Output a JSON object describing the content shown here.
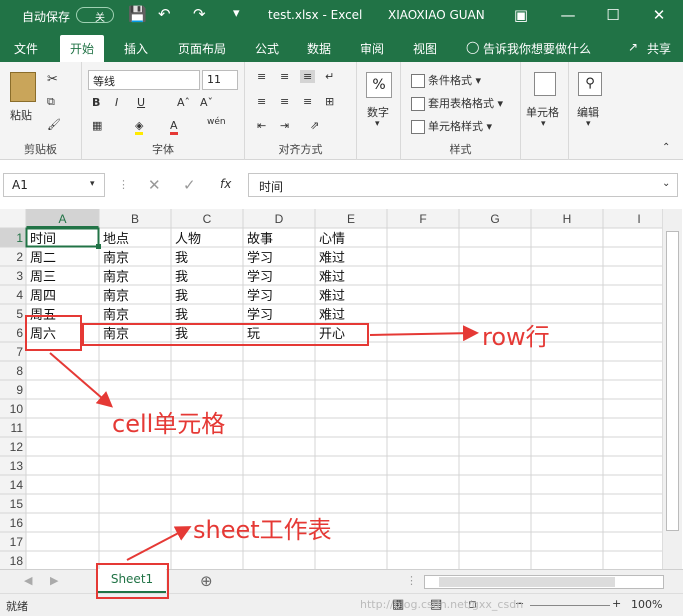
{
  "titlebar": {
    "autosave": "自动保存",
    "toggle": "关",
    "filename": "test.xlsx  -  Excel",
    "user": "XIAOXIAO GUAN"
  },
  "tabs": [
    "文件",
    "开始",
    "插入",
    "页面布局",
    "公式",
    "数据",
    "审阅",
    "视图"
  ],
  "tell_me": "告诉我你想要做什么",
  "share": "共享",
  "ribbon": {
    "paste": "粘贴",
    "clipboard": "剪贴板",
    "font_name": "等线",
    "font_size": "11",
    "font": "字体",
    "align": "对齐方式",
    "number": "数字",
    "cond_format": "条件格式",
    "table_format": "套用表格格式",
    "cell_style": "单元格样式",
    "styles": "样式",
    "cells": "单元格",
    "edit": "编辑"
  },
  "formula": {
    "namebox": "A1",
    "fx": "fx",
    "content": "时间"
  },
  "columns": [
    "A",
    "B",
    "C",
    "D",
    "E",
    "F",
    "G",
    "H",
    "I"
  ],
  "rows": [
    [
      "时间",
      "地点",
      "人物",
      "故事",
      "心情"
    ],
    [
      "周二",
      "南京",
      "我",
      "学习",
      "难过"
    ],
    [
      "周三",
      "南京",
      "我",
      "学习",
      "难过"
    ],
    [
      "周四",
      "南京",
      "我",
      "学习",
      "难过"
    ],
    [
      "周五",
      "南京",
      "我",
      "学习",
      "难过"
    ],
    [
      "周六",
      "南京",
      "我",
      "玩",
      "开心"
    ],
    [],
    [],
    [],
    [],
    [],
    [],
    [],
    [],
    [],
    [],
    [],
    []
  ],
  "sheet_tab": "Sheet1",
  "status": {
    "ready": "就绪",
    "zoom": "100%"
  },
  "annotations": {
    "row": "row行",
    "cell": "cell单元格",
    "sheet": "sheet工作表"
  },
  "watermark": "http://blog.csdn.net/gxx_csdn"
}
